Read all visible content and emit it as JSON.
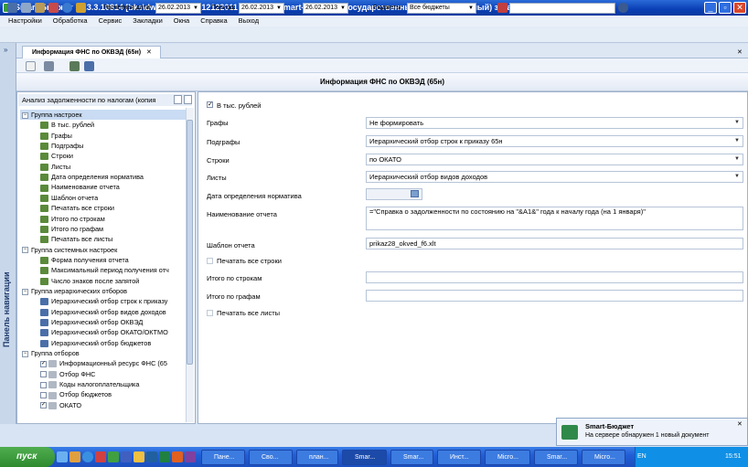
{
  "window": {
    "title": "Smart-Бюджет 12.3.3.10814 [bks\\dwh.bud2012_12122011 - vturin] - Smart-Бюджет - Государственный (муниципальный) заказ",
    "minimize": "_",
    "restore": "▫",
    "close": "✕"
  },
  "menu": [
    "Настройки",
    "Обработка",
    "Сервис",
    "Закладки",
    "Окна",
    "Справка",
    "Выход"
  ],
  "toolbar": {
    "calc_date_label": "Расчетная дата:",
    "calc_date_value": "26.02.2013",
    "period_label": "Период:",
    "period_from": "26.02.2013",
    "period_sep": "...",
    "period_to": "26.02.2013",
    "budgets_label": "Бюджеты:",
    "budgets_value": "Все бюджеты"
  },
  "nav_panel_label": "Панель навигации",
  "tab": {
    "label": "Информация ФНС по ОКВЭД (65н)",
    "close": "✕"
  },
  "header_title": "Информация ФНС по ОКВЭД (65н)",
  "left_panel": {
    "title": "Анализ задолженности по налогам (копия"
  },
  "tree": [
    {
      "label": "Группа настроек",
      "level": 0,
      "type": "group"
    },
    {
      "label": "В тыс. рублей",
      "level": 1,
      "type": "param"
    },
    {
      "label": "Графы",
      "level": 1,
      "type": "param"
    },
    {
      "label": "Подграфы",
      "level": 1,
      "type": "param"
    },
    {
      "label": "Строки",
      "level": 1,
      "type": "param"
    },
    {
      "label": "Листы",
      "level": 1,
      "type": "param"
    },
    {
      "label": "Дата определения норматива",
      "level": 1,
      "type": "param"
    },
    {
      "label": "Наименование отчета",
      "level": 1,
      "type": "param"
    },
    {
      "label": "Шаблон отчета",
      "level": 1,
      "type": "param"
    },
    {
      "label": "Печатать все строки",
      "level": 1,
      "type": "param"
    },
    {
      "label": "Итого по строкам",
      "level": 1,
      "type": "param"
    },
    {
      "label": "Итого по графам",
      "level": 1,
      "type": "param"
    },
    {
      "label": "Печатать все листы",
      "level": 1,
      "type": "param"
    },
    {
      "label": "Группа системных настроек",
      "level": 0,
      "type": "group"
    },
    {
      "label": "Форма получения отчета",
      "level": 1,
      "type": "param"
    },
    {
      "label": "Максимальный период получения отч",
      "level": 1,
      "type": "param"
    },
    {
      "label": "Число знаков после запятой",
      "level": 1,
      "type": "param"
    },
    {
      "label": "Группа иерархических отборов",
      "level": 0,
      "type": "group"
    },
    {
      "label": "Иерархический отбор строк к приказу",
      "level": 1,
      "type": "filter"
    },
    {
      "label": "Иерархический отбор видов доходов",
      "level": 1,
      "type": "filter"
    },
    {
      "label": "Иерархический отбор ОКВЭД",
      "level": 1,
      "type": "filter"
    },
    {
      "label": "Иерархический отбор ОКАТО/ОКТМО",
      "level": 1,
      "type": "filter"
    },
    {
      "label": "Иерархический отбор бюджетов",
      "level": 1,
      "type": "filter"
    },
    {
      "label": "Группа отборов",
      "level": 0,
      "type": "group"
    },
    {
      "label": "Информационный ресурс ФНС (65",
      "level": 1,
      "type": "check",
      "checked": true
    },
    {
      "label": "Отбор ФНС",
      "level": 1,
      "type": "check",
      "checked": false
    },
    {
      "label": "Коды налогоплательщика",
      "level": 1,
      "type": "check",
      "checked": false
    },
    {
      "label": "Отбор бюджетов",
      "level": 1,
      "type": "check",
      "checked": false
    },
    {
      "label": "ОКАТО",
      "level": 1,
      "type": "check",
      "checked": true
    }
  ],
  "params": {
    "thousands_label": "В тыс. рублей",
    "graphs_label": "Графы",
    "graphs_value": "Не формировать",
    "subgraphs_label": "Подграфы",
    "subgraphs_value": "Иерархический отбор строк к приказу 65н",
    "rows_label": "Строки",
    "rows_value": "по ОКАТО",
    "sheets_label": "Листы",
    "sheets_value": "Иерархический отбор видов доходов",
    "norm_date_label": "Дата определения норматива",
    "norm_date_value": "",
    "report_name_label": "Наименование отчета",
    "report_name_value": "=\"Справка о задолженности по состоянию на \"&A1&\" года к началу года (на 1 января)\"",
    "template_label": "Шаблон отчета",
    "template_value": "prikaz28_okved_f6.xlt",
    "print_rows_label": "Печатать все строки",
    "total_rows_label": "Итого по строкам",
    "total_cols_label": "Итого по графам",
    "print_sheets_label": "Печатать все листы"
  },
  "notification": {
    "title": "Smart-Бюджет",
    "text": "На сервере обнаружен 1 новый документ",
    "close": "✕"
  },
  "taskbar": {
    "start": "пуск",
    "items": [
      "Пане...",
      "Сво...",
      "план...",
      "Smar...",
      "Smar...",
      "Инст...",
      "Micro...",
      "Smar...",
      "Micro...",
      "Micro..."
    ],
    "lang": "EN",
    "clock": "15:51"
  },
  "colors": {
    "titlebar": "#0a3fb5",
    "taskbar": "#225ed6",
    "start": "#2f8a2f",
    "panel_bg": "#d8e4f3"
  }
}
